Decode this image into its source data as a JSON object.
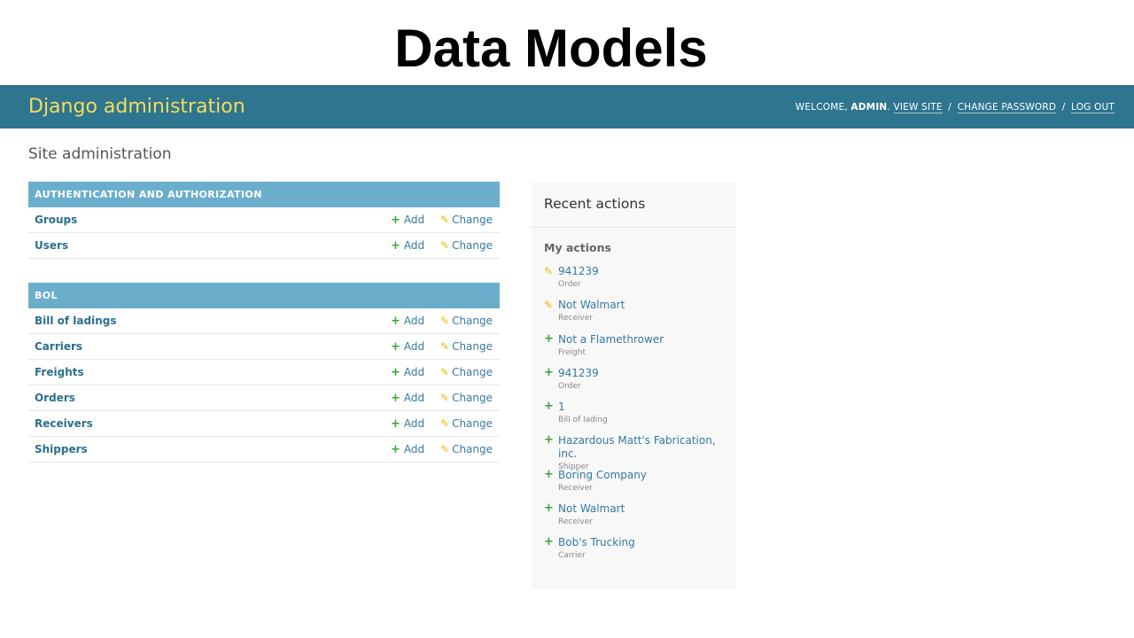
{
  "slide_title": "Data Models",
  "header": {
    "brand": "Django administration",
    "welcome": "WELCOME, ",
    "username": "ADMIN",
    "after_user": ". ",
    "view_site": "VIEW SITE",
    "change_password": "CHANGE PASSWORD",
    "log_out": "LOG OUT",
    "separator": "/"
  },
  "page_heading": "Site administration",
  "labels": {
    "add": "Add",
    "change": "Change"
  },
  "modules": [
    {
      "title": "AUTHENTICATION AND AUTHORIZATION",
      "models": [
        "Groups",
        "Users"
      ]
    },
    {
      "title": "BOL",
      "models": [
        "Bill of ladings",
        "Carriers",
        "Freights",
        "Orders",
        "Receivers",
        "Shippers"
      ]
    }
  ],
  "recent": {
    "title": "Recent actions",
    "subtitle": "My actions",
    "items": [
      {
        "icon": "change",
        "object": "941239",
        "type": "Order"
      },
      {
        "icon": "change",
        "object": "Not Walmart",
        "type": "Receiver"
      },
      {
        "icon": "add",
        "object": "Not a Flamethrower",
        "type": "Freight"
      },
      {
        "icon": "add",
        "object": "941239",
        "type": "Order"
      },
      {
        "icon": "add",
        "object": "1",
        "type": "Bill of lading"
      },
      {
        "icon": "add",
        "object": "Hazardous Matt's Fabrication, inc.",
        "type": "Shipper"
      },
      {
        "icon": "add",
        "object": "Boring Company",
        "type": "Receiver"
      },
      {
        "icon": "add",
        "object": "Not Walmart",
        "type": "Receiver"
      },
      {
        "icon": "add",
        "object": "Bob's Trucking",
        "type": "Carrier"
      }
    ]
  },
  "colors": {
    "header_bg": "#2e7590",
    "brand": "#f5dd5d",
    "module_head": "#6aaecc",
    "link": "#3679a0",
    "add_icon": "#3aa537",
    "change_icon": "#efb80b"
  }
}
